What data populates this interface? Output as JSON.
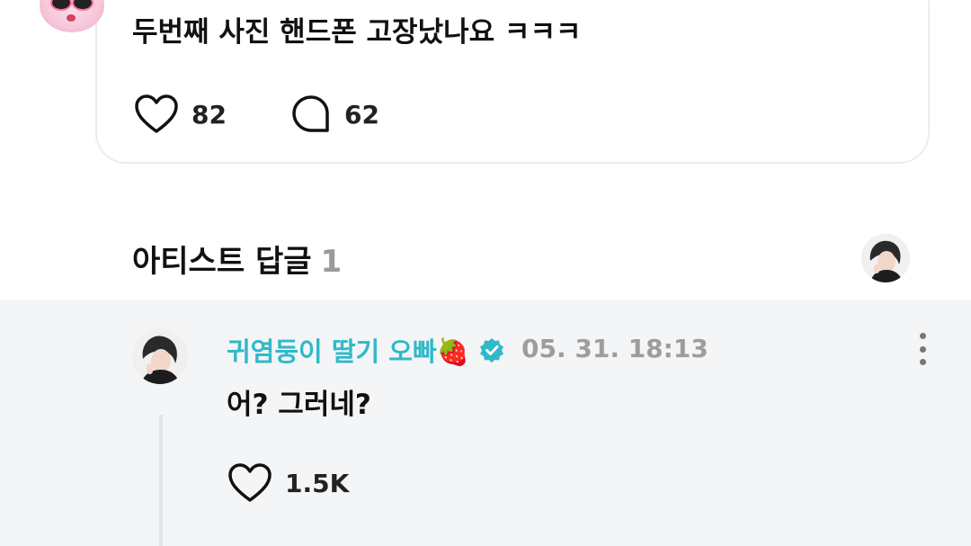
{
  "post": {
    "text": "두번째 사진 핸드폰 고장났나요 ㅋㅋㅋ",
    "likes": "82",
    "comments": "62"
  },
  "artist_replies": {
    "title": "아티스트 답글",
    "count": "1"
  },
  "reply": {
    "author": "귀염둥이 딸기 오빠🍓",
    "date": "05. 31. 18:13",
    "text": "어? 그러네?",
    "likes": "1.5K"
  },
  "colors": {
    "accent": "#2fb9c9",
    "muted": "#9d9d9d",
    "reply_bg": "#f4f5f7"
  },
  "icons": {
    "like": "heart-icon",
    "comment": "comment-bubble-icon",
    "verified": "verified-badge-icon",
    "more": "more-vertical-icon"
  }
}
